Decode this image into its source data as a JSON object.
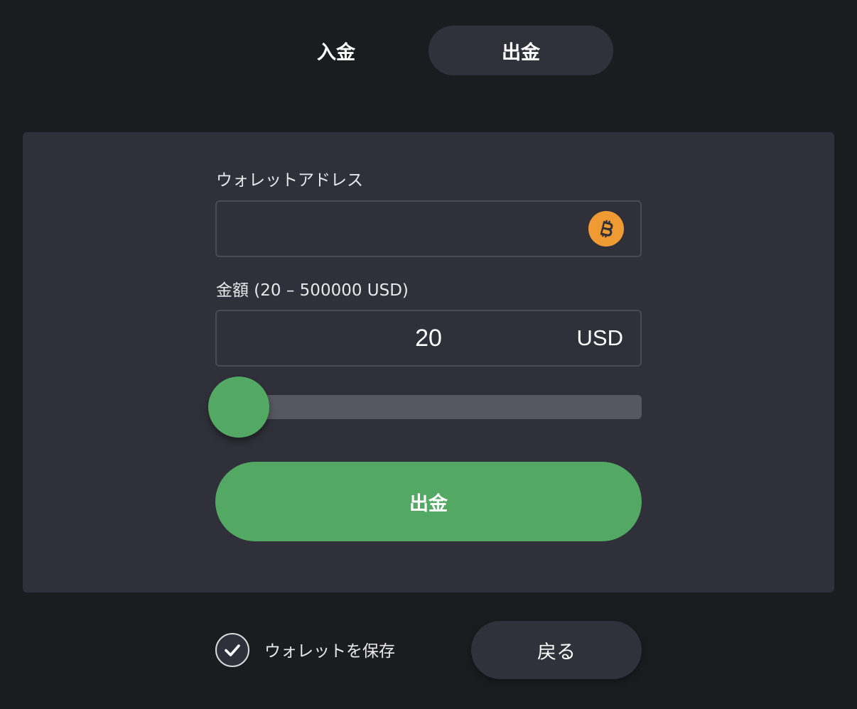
{
  "tabs": {
    "deposit_label": "入金",
    "withdraw_label": "出金",
    "active": "withdraw"
  },
  "form": {
    "wallet_label": "ウォレットアドレス",
    "wallet_value": "",
    "wallet_currency_icon": "bitcoin-icon",
    "amount_label": "金額 (20 – 500000 USD)",
    "amount_value": "20",
    "amount_unit": "USD",
    "slider_level_fraction": 0,
    "submit_label": "出金"
  },
  "footer": {
    "save_wallet_label": "ウォレットを保存",
    "save_wallet_checked": true,
    "back_label": "戻る"
  },
  "colors": {
    "background": "#1b1c20",
    "card": "#2f3039",
    "accent_green": "#53a964",
    "bitcoin_orange": "#f09a33"
  }
}
